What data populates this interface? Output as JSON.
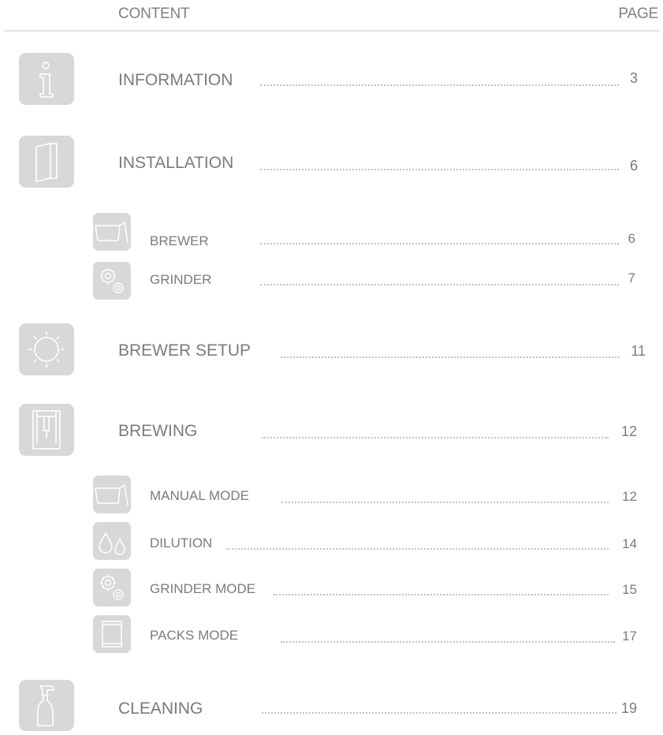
{
  "header": {
    "content_label": "CONTENT",
    "page_label": "PAGE"
  },
  "entries": [
    {
      "label": "INFORMATION",
      "page": "3",
      "icon": "info-icon"
    },
    {
      "label": "INSTALLATION",
      "page": "6",
      "icon": "manual-book-icon"
    },
    {
      "label": "BREWER",
      "page": "6",
      "icon": "brewer-basket-icon"
    },
    {
      "label": "GRINDER",
      "page": "7",
      "icon": "grinder-gears-icon"
    },
    {
      "label": "BREWER SETUP",
      "page": "11",
      "icon": "setup-gear-icon"
    },
    {
      "label": "BREWING",
      "page": "12",
      "icon": "brewer-tower-icon"
    },
    {
      "label": "MANUAL MODE",
      "page": "12",
      "icon": "brewer-basket-icon"
    },
    {
      "label": "DILUTION",
      "page": "14",
      "icon": "water-drops-icon"
    },
    {
      "label": "GRINDER MODE",
      "page": "15",
      "icon": "grinder-gears-icon"
    },
    {
      "label": "PACKS MODE",
      "page": "17",
      "icon": "coffee-pack-icon"
    },
    {
      "label": "CLEANING",
      "page": "19",
      "icon": "spray-bottle-icon"
    }
  ]
}
